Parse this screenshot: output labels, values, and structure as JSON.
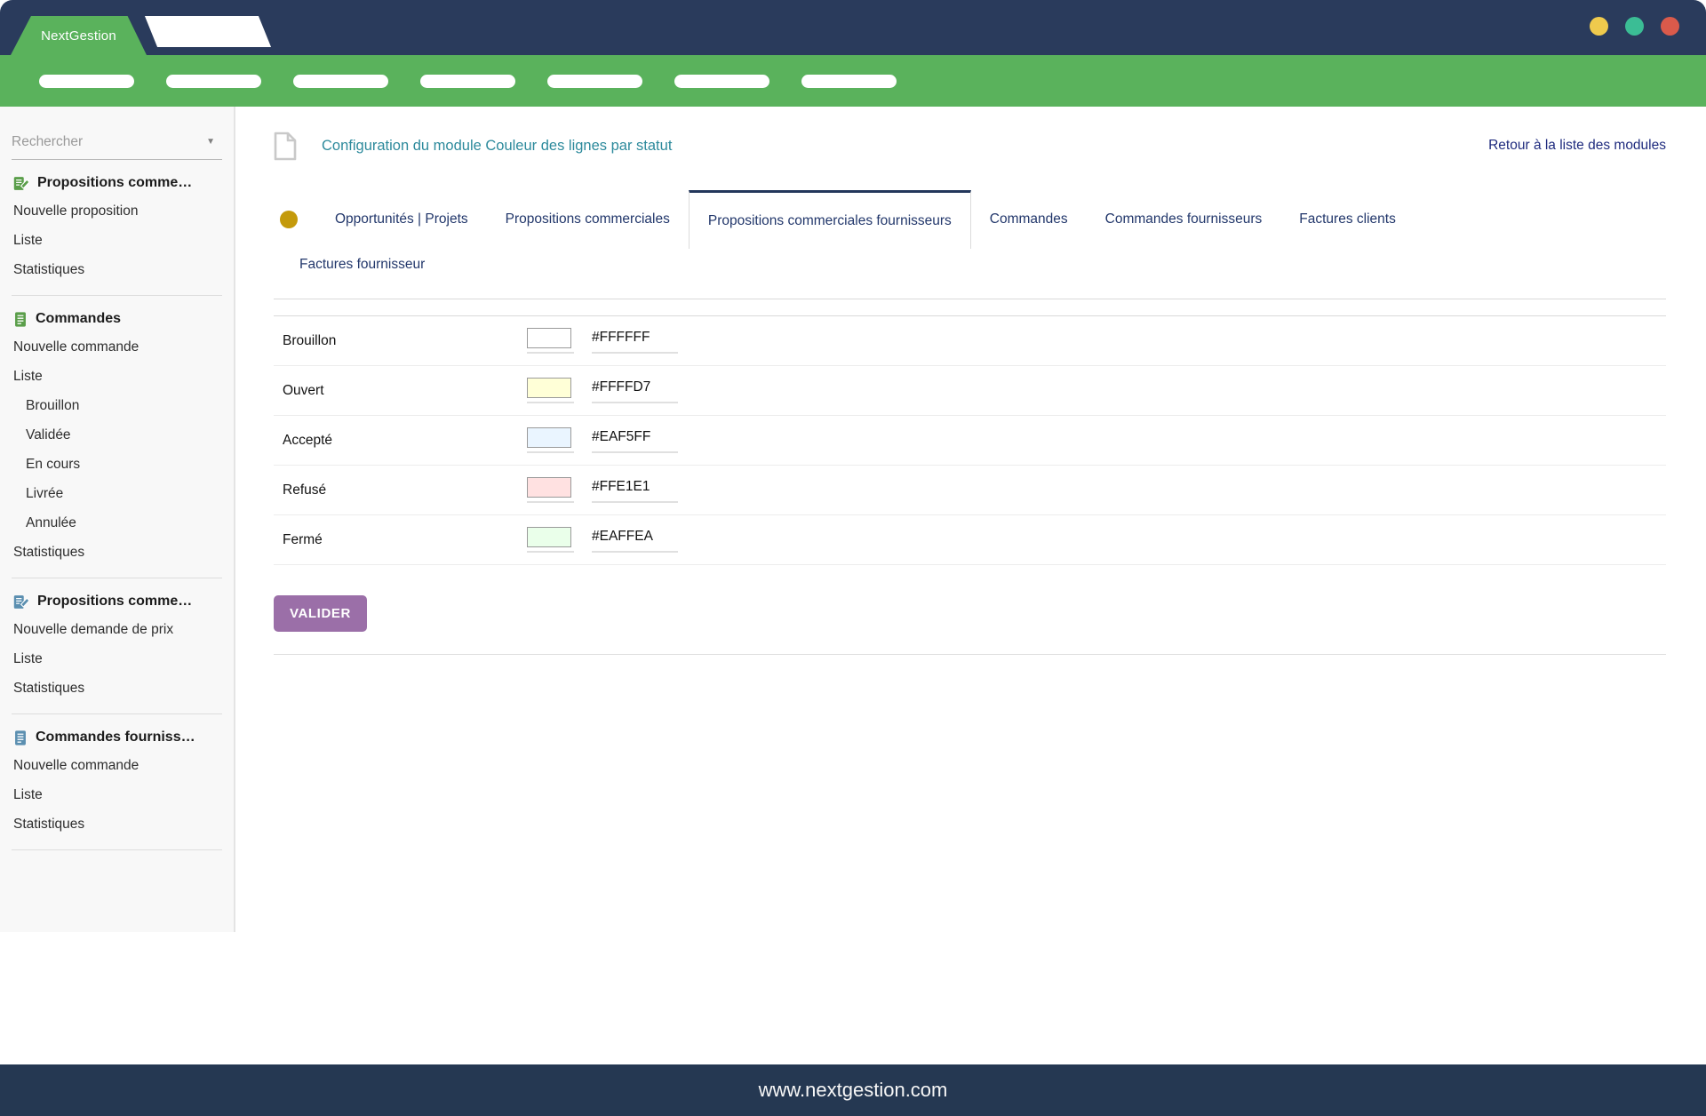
{
  "theme": {
    "header_navy": "#2A3B5C",
    "nav_green": "#5AB25C",
    "footer_navy": "#253852",
    "title_teal": "#2D8A9C",
    "link_navy": "#1F2B7E",
    "tab_navy": "#22376B",
    "tab_active_border": "#22365B",
    "gold": "#C49A0B",
    "purple": "#9B6FA8",
    "icon_green": "#5A9E4A",
    "icon_blue": "#5B8FB0"
  },
  "header": {
    "brand": "NextGestion",
    "window_dots": [
      "#EFCA4D",
      "#3BBD95",
      "#DA5A4B"
    ]
  },
  "sidebar": {
    "search_placeholder": "Rechercher",
    "groups": [
      {
        "label": "Propositions comme…",
        "icon": "document-pencil-green",
        "items": [
          {
            "label": "Nouvelle proposition"
          },
          {
            "label": "Liste"
          },
          {
            "label": "Statistiques"
          }
        ]
      },
      {
        "label": "Commandes",
        "icon": "document-lines-green",
        "items": [
          {
            "label": "Nouvelle commande"
          },
          {
            "label": "Liste"
          },
          {
            "label": "Brouillon",
            "indent": true
          },
          {
            "label": "Validée",
            "indent": true
          },
          {
            "label": "En cours",
            "indent": true
          },
          {
            "label": "Livrée",
            "indent": true
          },
          {
            "label": "Annulée",
            "indent": true
          },
          {
            "label": "Statistiques"
          }
        ]
      },
      {
        "label": "Propositions comme…",
        "icon": "document-pencil-blue",
        "items": [
          {
            "label": "Nouvelle demande de prix"
          },
          {
            "label": "Liste"
          },
          {
            "label": "Statistiques"
          }
        ]
      },
      {
        "label": "Commandes fourniss…",
        "icon": "document-lines-blue",
        "items": [
          {
            "label": "Nouvelle commande"
          },
          {
            "label": "Liste"
          },
          {
            "label": "Statistiques"
          }
        ]
      }
    ]
  },
  "main": {
    "title": "Configuration du module Couleur des lignes par statut",
    "back_link": "Retour à la liste des modules",
    "tabs_row1": [
      "Opportunités | Projets",
      "Propositions commerciales",
      "Propositions commerciales fournisseurs",
      "Commandes",
      "Commandes fournisseurs",
      "Factures clients"
    ],
    "tabs_row2": [
      "Factures fournisseur"
    ],
    "active_tab": "Propositions commerciales fournisseurs",
    "status_rows": [
      {
        "label": "Brouillon",
        "hex": "#FFFFFF"
      },
      {
        "label": "Ouvert",
        "hex": "#FFFFD7"
      },
      {
        "label": "Accepté",
        "hex": "#EAF5FF"
      },
      {
        "label": "Refusé",
        "hex": "#FFE1E1"
      },
      {
        "label": "Fermé",
        "hex": "#EAFFEA"
      }
    ],
    "submit_label": "VALIDER"
  },
  "footer": {
    "url": "www.nextgestion.com"
  }
}
